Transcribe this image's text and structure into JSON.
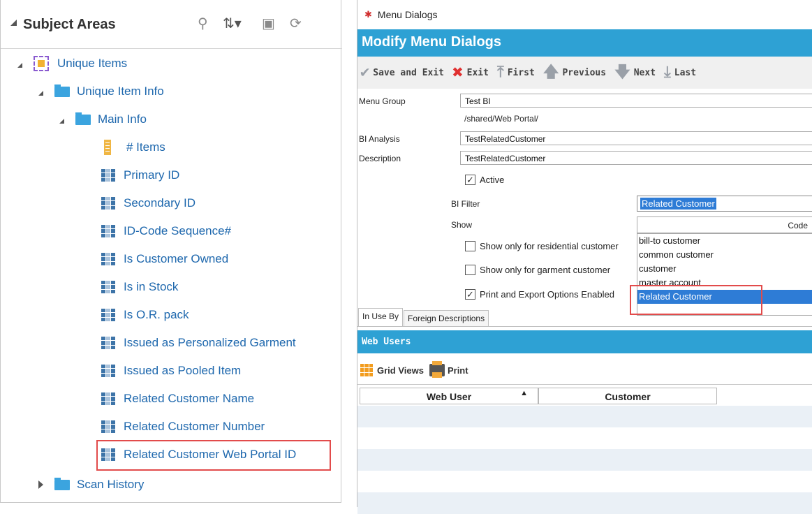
{
  "subject_areas": {
    "title": "Subject Areas",
    "header_icons": [
      "search-icon",
      "sort-icon",
      "add-icon",
      "refresh-icon"
    ],
    "tree": [
      {
        "label": "Unique Items",
        "level": 0,
        "type": "subject-area",
        "expanded": true
      },
      {
        "label": "Unique Item Info",
        "level": 1,
        "type": "folder",
        "expanded": true
      },
      {
        "label": "Main Info",
        "level": 2,
        "type": "folder",
        "expanded": true
      },
      {
        "label": "# Items",
        "level": 3,
        "type": "measure"
      },
      {
        "label": "Primary ID",
        "level": 3,
        "type": "attribute"
      },
      {
        "label": "Secondary ID",
        "level": 3,
        "type": "attribute"
      },
      {
        "label": "ID-Code Sequence#",
        "level": 3,
        "type": "attribute"
      },
      {
        "label": "Is Customer Owned",
        "level": 3,
        "type": "attribute"
      },
      {
        "label": "Is in Stock",
        "level": 3,
        "type": "attribute"
      },
      {
        "label": "Is O.R. pack",
        "level": 3,
        "type": "attribute"
      },
      {
        "label": "Issued as Personalized Garment",
        "level": 3,
        "type": "attribute"
      },
      {
        "label": "Issued as Pooled Item",
        "level": 3,
        "type": "attribute"
      },
      {
        "label": "Related Customer Name",
        "level": 3,
        "type": "attribute"
      },
      {
        "label": "Related Customer Number",
        "level": 3,
        "type": "attribute"
      },
      {
        "label": "Related Customer Web Portal ID",
        "level": 3,
        "type": "attribute",
        "highlighted": true
      },
      {
        "label": "Scan History",
        "level": 1,
        "type": "folder",
        "expanded": false
      }
    ]
  },
  "dialog": {
    "window_title": "Menu Dialogs",
    "banner": "Modify Menu Dialogs",
    "toolbar": {
      "save_exit": "Save and Exit",
      "exit": "Exit",
      "first": "First",
      "previous": "Previous",
      "next": "Next",
      "last": "Last"
    },
    "form": {
      "menu_group_label": "Menu Group",
      "menu_group_value": "Test BI",
      "path": "/shared/Web Portal/",
      "bi_analysis_label": "BI Analysis",
      "bi_analysis_value": "TestRelatedCustomer",
      "description_label": "Description",
      "description_value": "TestRelatedCustomer",
      "active_label": "Active",
      "active_checked": true,
      "bi_filter_label": "BI Filter",
      "bi_filter_value": "Related Customer",
      "show_label": "Show",
      "code_header": "Code",
      "residential_label": "Show only for residential customer",
      "residential_checked": false,
      "garment_label": "Show only for garment customer",
      "garment_checked": false,
      "print_export_label": "Print and Export Options Enabled",
      "print_export_checked": true
    },
    "code_options": [
      {
        "label": "bill-to customer",
        "selected": false
      },
      {
        "label": "common customer",
        "selected": false
      },
      {
        "label": "customer",
        "selected": false
      },
      {
        "label": "master account",
        "selected": false
      },
      {
        "label": "Related Customer",
        "selected": true
      }
    ],
    "tabs": [
      {
        "label": "In Use By",
        "active": true
      },
      {
        "label": "Foreign Descriptions",
        "active": false
      }
    ],
    "web_users": {
      "title": "Web Users",
      "grid_views": "Grid Views",
      "print": "Print",
      "columns": [
        "Web User",
        "Customer"
      ]
    },
    "accent_color": "#2ea1d4",
    "highlight_color": "#e24b4b",
    "selection_color": "#2e7cd6"
  }
}
